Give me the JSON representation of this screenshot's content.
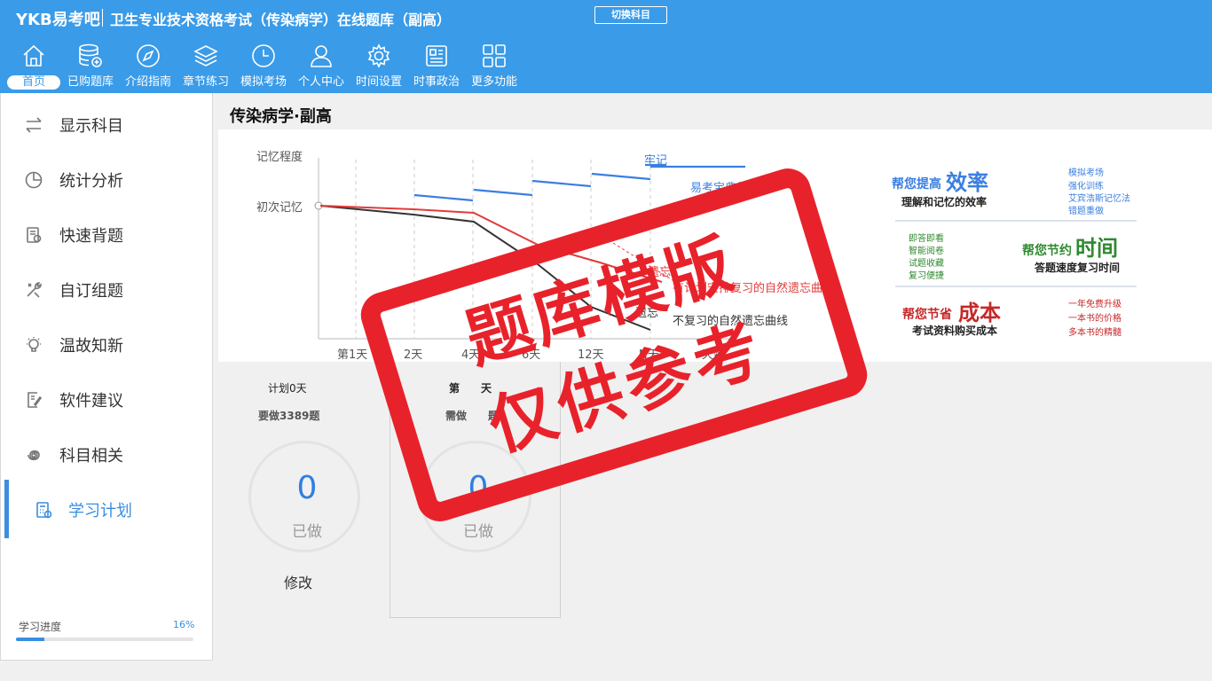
{
  "header": {
    "brand": "YKB易考吧",
    "title": "卫生专业技术资格考试（传染病学）在线题库（副高）",
    "switch_label": "切换科目"
  },
  "nav": [
    {
      "label": "首页",
      "icon": "home-icon"
    },
    {
      "label": "已购题库",
      "icon": "database-icon"
    },
    {
      "label": "介绍指南",
      "icon": "compass-icon"
    },
    {
      "label": "章节练习",
      "icon": "layers-icon"
    },
    {
      "label": "模拟考场",
      "icon": "clock-icon"
    },
    {
      "label": "个人中心",
      "icon": "user-icon"
    },
    {
      "label": "时间设置",
      "icon": "gear-icon"
    },
    {
      "label": "时事政治",
      "icon": "news-icon"
    },
    {
      "label": "更多功能",
      "icon": "grid-icon"
    }
  ],
  "sidebar": {
    "items": [
      {
        "label": "显示科目",
        "icon": "swap-icon"
      },
      {
        "label": "统计分析",
        "icon": "pie-chart-icon"
      },
      {
        "label": "快速背题",
        "icon": "book-icon"
      },
      {
        "label": "自订组题",
        "icon": "tools-icon"
      },
      {
        "label": "温故知新",
        "icon": "bulb-icon"
      },
      {
        "label": "软件建议",
        "icon": "edit-doc-icon"
      },
      {
        "label": "科目相关",
        "icon": "spiral-icon"
      },
      {
        "label": "学习计划",
        "icon": "calculator-icon"
      }
    ],
    "progress_label": "学习进度",
    "progress_percent_text": "16%",
    "progress_value": 0.16
  },
  "main": {
    "title": "传染病学·副高"
  },
  "banner": {
    "y_label": "记忆程度",
    "first_memory": "初次记忆",
    "remember_label": "牢记",
    "ykb_curve_label": "易考宝典复习",
    "planned_curve_label": "有计划安排复习的自然遗忘曲线",
    "forget_label_1": "遗忘",
    "forget_label_2": "遗忘",
    "no_review_label": "不复习的自然遗忘曲线",
    "x_ticks": [
      "第1天",
      "2天",
      "4天",
      "6天",
      "12天",
      "N天",
      "天数"
    ],
    "efficiency_title_small": "帮您提高",
    "efficiency_title_big": "效率",
    "efficiency_sub": "理解和记忆的效率",
    "efficiency_points": [
      "模拟考场",
      "强化训练",
      "艾宾浩斯记忆法",
      "错题重做"
    ],
    "time_points": [
      "即答即看",
      "智能阅卷",
      "试题收藏",
      "复习便捷"
    ],
    "time_title_small": "帮您节约",
    "time_title_big": "时间",
    "time_sub": "答题速度复习时间",
    "cost_title_small": "帮您节省",
    "cost_title_big": "成本",
    "cost_sub": "考试资料购买成本",
    "cost_points": [
      "一年免费升级",
      "一本书的价格",
      "多本书的精髓"
    ],
    "colors": {
      "blue_curve": "#3a7fe0",
      "red_curve": "#e23b3b",
      "black_curve": "#333333",
      "green_text": "#2f8a2f"
    }
  },
  "plan": {
    "plan_days": "计划0天",
    "must_do": "要做3389题",
    "day_label": "第　　天",
    "need_do": "需做　　题",
    "done_count_1": "0",
    "done_label_1": "已做",
    "done_count_2": "0",
    "done_label_2": "已做",
    "modify": "修改"
  },
  "watermark": {
    "line1": "题库模版",
    "line2": "仅供参考",
    "color": "#e8222b"
  }
}
